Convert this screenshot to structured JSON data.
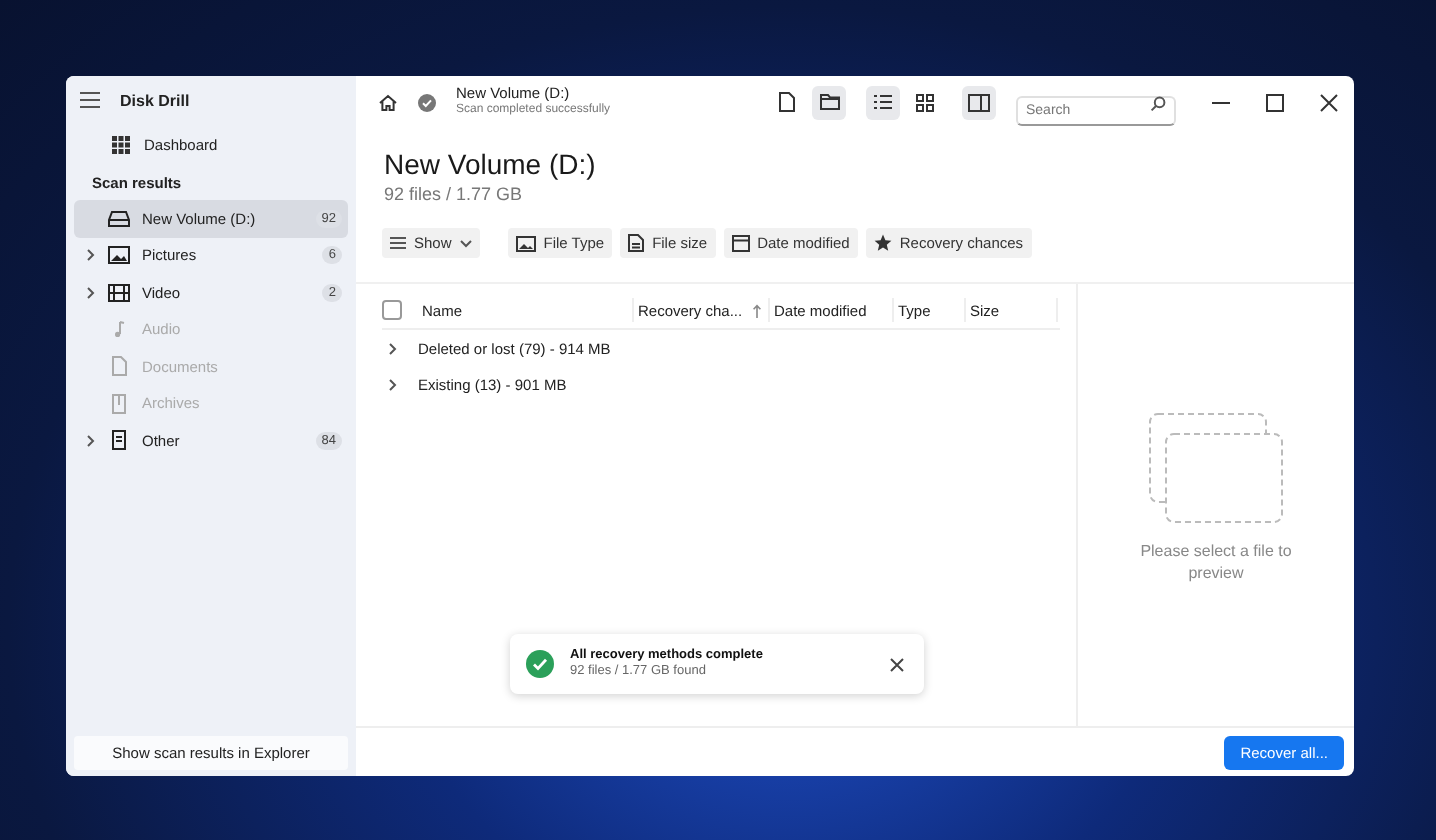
{
  "app": {
    "title": "Disk Drill"
  },
  "sidebar": {
    "dashboard": "Dashboard",
    "section": "Scan results",
    "items": [
      {
        "label": "New Volume (D:)",
        "kind": "drive",
        "count": "92",
        "selected": true,
        "expandable": false,
        "disabled": false
      },
      {
        "label": "Pictures",
        "kind": "pictures",
        "count": "6",
        "selected": false,
        "expandable": true,
        "disabled": false
      },
      {
        "label": "Video",
        "kind": "video",
        "count": "2",
        "selected": false,
        "expandable": true,
        "disabled": false
      },
      {
        "label": "Audio",
        "kind": "audio",
        "selected": false,
        "expandable": false,
        "disabled": true
      },
      {
        "label": "Documents",
        "kind": "documents",
        "selected": false,
        "expandable": false,
        "disabled": true
      },
      {
        "label": "Archives",
        "kind": "archives",
        "selected": false,
        "expandable": false,
        "disabled": true
      },
      {
        "label": "Other",
        "kind": "other",
        "count": "84",
        "selected": false,
        "expandable": true,
        "disabled": false
      }
    ],
    "footer_button": "Show scan results in Explorer"
  },
  "header": {
    "title": "New Volume (D:)",
    "status": "Scan completed successfully",
    "view_buttons": [
      {
        "kind": "file",
        "selected": false
      },
      {
        "kind": "folder",
        "selected": true
      },
      {
        "kind": "list",
        "selected": true
      },
      {
        "kind": "grid",
        "selected": false
      },
      {
        "kind": "pane",
        "selected": true
      }
    ],
    "search": {
      "placeholder": "Search"
    }
  },
  "page": {
    "title": "New Volume (D:)",
    "summary": "92 files / 1.77 GB"
  },
  "filters": [
    {
      "label": "Show",
      "kind": "show"
    },
    {
      "label": "File Type",
      "kind": "type"
    },
    {
      "label": "File size",
      "kind": "size"
    },
    {
      "label": "Date modified",
      "kind": "date"
    },
    {
      "label": "Recovery chances",
      "kind": "chances"
    }
  ],
  "table": {
    "select_all": {
      "checked": false
    },
    "columns": [
      {
        "label": "Name",
        "sorted": false
      },
      {
        "label": "Recovery cha...",
        "sorted": true
      },
      {
        "label": "Date modified",
        "sorted": false
      },
      {
        "label": "Type",
        "sorted": false
      },
      {
        "label": "Size",
        "sorted": false
      }
    ],
    "rows": [
      {
        "label": "Deleted or lost (79) - 914 MB",
        "expanded": false
      },
      {
        "label": "Existing (13) - 901 MB",
        "expanded": false
      }
    ]
  },
  "toast": {
    "title": "All recovery methods complete",
    "subtitle": "92 files / 1.77 GB found"
  },
  "preview": {
    "message": "Please select a file to preview"
  },
  "recover_button": "Recover all..."
}
